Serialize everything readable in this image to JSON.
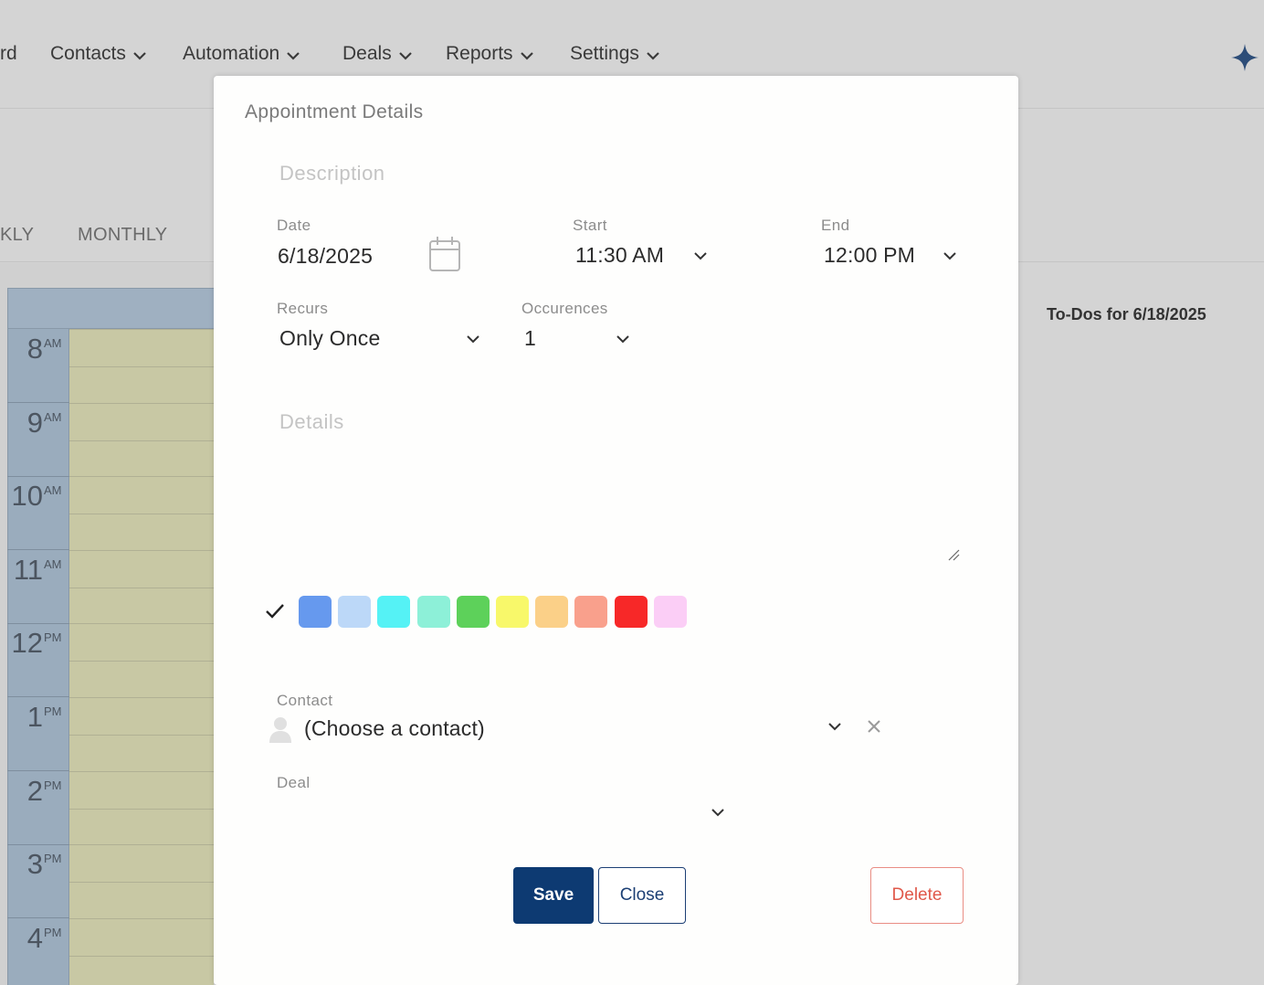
{
  "nav": {
    "items": [
      {
        "label": "rd",
        "chevron": false
      },
      {
        "label": "Contacts",
        "chevron": true
      },
      {
        "label": "Automation",
        "chevron": true
      },
      {
        "label": "Deals",
        "chevron": true
      },
      {
        "label": "Reports",
        "chevron": true
      },
      {
        "label": "Settings",
        "chevron": true
      }
    ],
    "assistant_icon": "sparkle-icon"
  },
  "view_tabs": [
    "KLY",
    "MONTHLY"
  ],
  "calendar": {
    "hours": [
      {
        "hour": "8",
        "ampm": "AM"
      },
      {
        "hour": "9",
        "ampm": "AM"
      },
      {
        "hour": "10",
        "ampm": "AM"
      },
      {
        "hour": "11",
        "ampm": "AM"
      },
      {
        "hour": "12",
        "ampm": "PM"
      },
      {
        "hour": "1",
        "ampm": "PM"
      },
      {
        "hour": "2",
        "ampm": "PM"
      },
      {
        "hour": "3",
        "ampm": "PM"
      },
      {
        "hour": "4",
        "ampm": "PM"
      }
    ]
  },
  "todos": {
    "title": "To-Dos for 6/18/2025"
  },
  "modal": {
    "title": "Appointment Details",
    "description_placeholder": "Description",
    "date": {
      "label": "Date",
      "value": "6/18/2025"
    },
    "start": {
      "label": "Start",
      "value": "11:30 AM"
    },
    "end": {
      "label": "End",
      "value": "12:00 PM"
    },
    "recurs": {
      "label": "Recurs",
      "value": "Only Once"
    },
    "occurrences": {
      "label": "Occurences",
      "value": "1"
    },
    "details_placeholder": "Details",
    "colors": [
      "#6699ee",
      "#bcd8f8",
      "#55f2f5",
      "#8df0d8",
      "#5dd15a",
      "#f8f86a",
      "#fbd088",
      "#f9a08c",
      "#f72828",
      "#fbcef6"
    ],
    "contact": {
      "label": "Contact",
      "value": "(Choose a contact)"
    },
    "deal": {
      "label": "Deal",
      "value": ""
    },
    "buttons": {
      "save": "Save",
      "close": "Close",
      "delete": "Delete"
    }
  }
}
